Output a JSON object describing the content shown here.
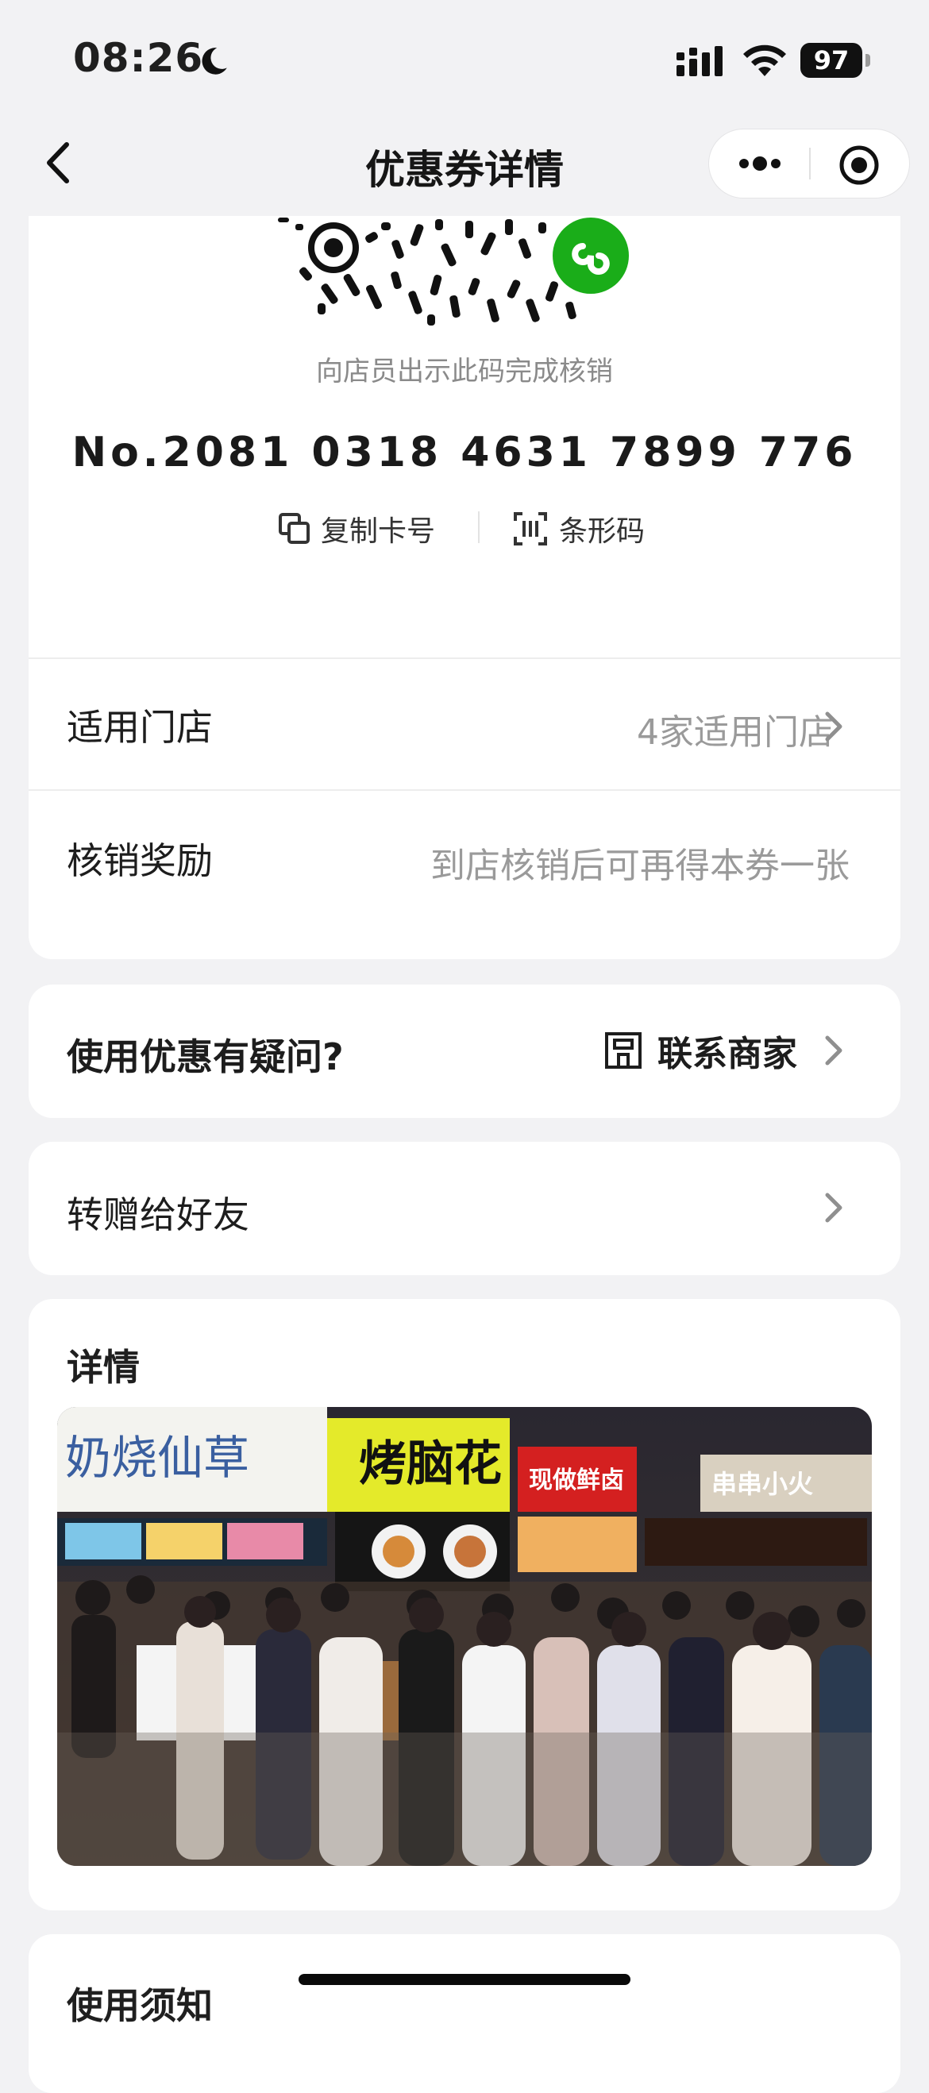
{
  "status_bar": {
    "time": "08:26",
    "battery": "97",
    "icons": [
      "moon-icon",
      "signal-icon",
      "wifi-icon",
      "battery-icon"
    ]
  },
  "nav": {
    "title": "优惠券详情",
    "back_icon": "chevron-left-icon",
    "more_icon": "more-dots-icon",
    "close_icon": "target-close-icon"
  },
  "code_card": {
    "qr_hint": "向店员出示此码完成核销",
    "card_number": "No.2081 0318 4631 7899 776",
    "copy_label": "复制卡号",
    "barcode_label": "条形码"
  },
  "rows": {
    "stores_label": "适用门店",
    "stores_value": "4家适用门店",
    "reward_label": "核销奖励",
    "reward_value": "到店核销后可再得本券一张"
  },
  "question": {
    "label": "使用优惠有疑问?",
    "contact_label": "联系商家"
  },
  "gift": {
    "label": "转赠给好友"
  },
  "details": {
    "title": "详情",
    "photo_signs": [
      "奶烧仙草",
      "烤脑花",
      "现做鲜卤",
      "串串小火"
    ]
  },
  "notice": {
    "title": "使用须知"
  },
  "colors": {
    "background": "#f2f2f4",
    "card": "#ffffff",
    "miniprogram_green": "#1aad19",
    "muted_text": "#9a9a9a"
  }
}
